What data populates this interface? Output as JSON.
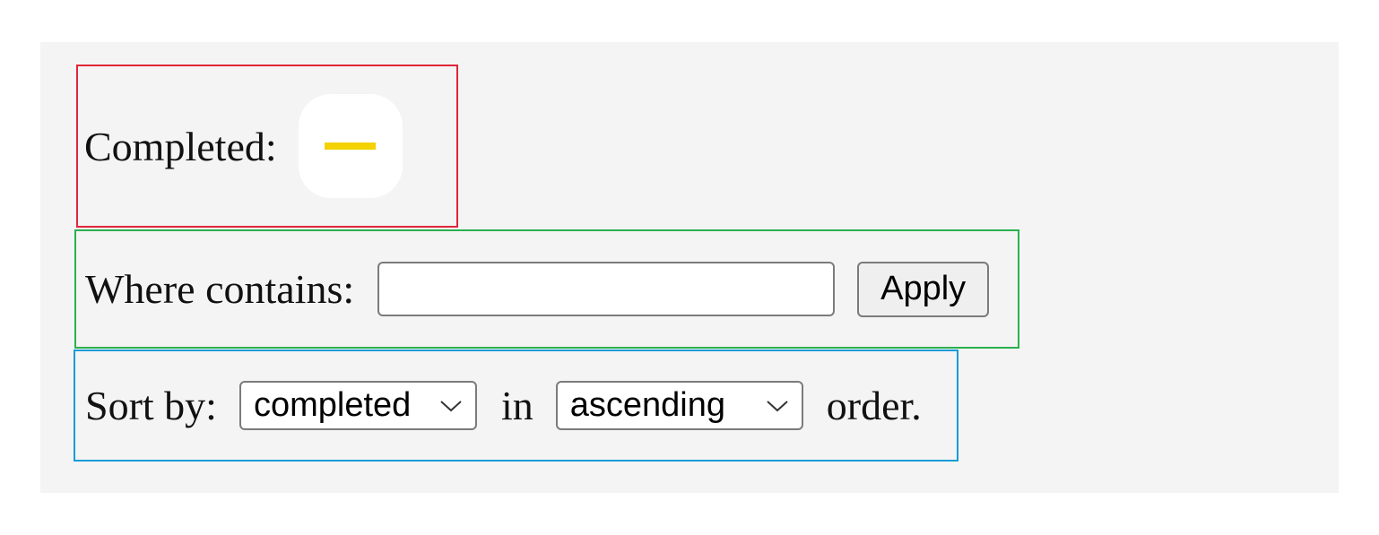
{
  "completed_filter": {
    "label": "Completed:",
    "state": "indeterminate",
    "indicator_color": "#f3d200"
  },
  "text_filter": {
    "label": "Where contains:",
    "value": "",
    "placeholder": "",
    "apply_label": "Apply"
  },
  "sort": {
    "prefix": "Sort by:",
    "field_value": "completed",
    "connector": "in",
    "order_value": "ascending",
    "suffix": "order."
  },
  "colors": {
    "completed_box_border": "#e0263a",
    "filter_box_border": "#2bb04e",
    "sort_box_border": "#1a9bd8",
    "panel_background": "#f4f4f4"
  },
  "icons": {
    "toggle_indicator": "dash-icon",
    "select_arrow": "chevron-down-icon"
  }
}
